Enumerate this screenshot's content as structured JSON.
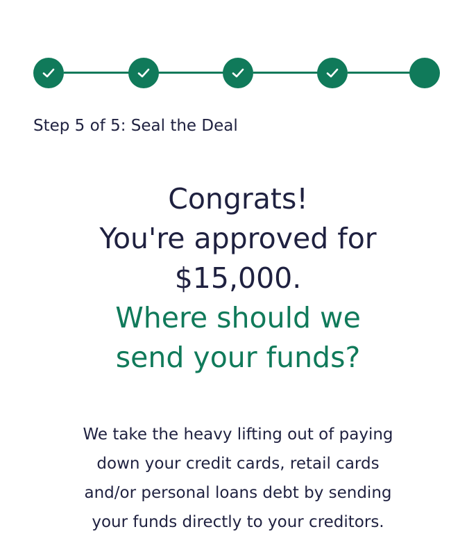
{
  "stepper": {
    "current_step": 5,
    "total_steps": 5,
    "completed_steps": 4,
    "step_icons": [
      "check-icon",
      "check-icon",
      "check-icon",
      "check-icon",
      "filled-dot"
    ],
    "color": "#107a5a"
  },
  "step_caption": "Step 5 of 5: Seal the Deal",
  "headline": {
    "line1": "Congrats!",
    "line2": "You're approved for",
    "line3": "$15,000.",
    "question_line1": "Where should we",
    "question_line2": "send your funds?"
  },
  "body": {
    "line1": "We take the heavy lifting out of paying",
    "line2": "down your credit cards, retail cards",
    "line3": "and/or personal loans debt by sending",
    "line4": "your funds directly to your creditors."
  },
  "colors": {
    "accent": "#107a5a",
    "text": "#1f2140",
    "background": "#ffffff"
  }
}
